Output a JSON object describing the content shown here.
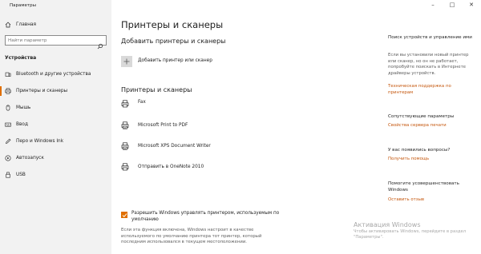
{
  "window": {
    "title": "Параметры",
    "controls": {
      "minimize": "–",
      "maximize": "□",
      "close": "✕"
    }
  },
  "sidebar": {
    "home": {
      "label": "Главная",
      "icon": "home-icon"
    },
    "search": {
      "placeholder": "Найти параметр"
    },
    "section": "Устройства",
    "items": [
      {
        "label": "Bluetooth и другие устройства",
        "icon": "bluetooth-icon"
      },
      {
        "label": "Принтеры и сканеры",
        "icon": "printer-icon",
        "active": true
      },
      {
        "label": "Мышь",
        "icon": "mouse-icon"
      },
      {
        "label": "Ввод",
        "icon": "keyboard-icon"
      },
      {
        "label": "Перо и Windows Ink",
        "icon": "pen-icon"
      },
      {
        "label": "Автозапуск",
        "icon": "autoplay-icon"
      },
      {
        "label": "USB",
        "icon": "usb-icon"
      }
    ]
  },
  "main": {
    "title": "Принтеры и сканеры",
    "add_section": {
      "title": "Добавить принтеры и сканеры",
      "button_label": "Добавить принтер или сканер"
    },
    "printers_section": {
      "title": "Принтеры и сканеры",
      "printers": [
        {
          "name": "Fax",
          "icon": "fax-icon"
        },
        {
          "name": "Microsoft Print to PDF",
          "icon": "printer-document-icon"
        },
        {
          "name": "Microsoft XPS Document Writer",
          "icon": "printer-document-icon"
        },
        {
          "name": "Отправить в OneNote 2010",
          "icon": "printer-icon"
        }
      ]
    },
    "default_printer": {
      "checked": true,
      "label": "Разрешить Windows управлять принтером, используемым по умолчанию",
      "description": "Если эта функция включена, Windows настроит в качестве используемого по умолчанию принтера тот принтер, который последним использовался в текущем местоположении."
    }
  },
  "right": {
    "troubleshoot": {
      "heading": "Поиск устройств и управление ими",
      "text": "Если вы установили новый принтер или сканер, но он не работает, попробуйте поискать в Интернете драйверы устройств.",
      "link": "Техническая поддержка по принтерам"
    },
    "related": {
      "heading": "Сопутствующие параметры",
      "link": "Свойства сервера печати"
    },
    "questions": {
      "heading": "У вас появились вопросы?",
      "link": "Получить помощь"
    },
    "feedback": {
      "heading": "Помогите усовершенствовать Windows",
      "link": "Оставить отзыв"
    }
  },
  "watermark": {
    "title": "Активация Windows",
    "text": "Чтобы активировать Windows, перейдите в раздел \"Параметры\"."
  },
  "colors": {
    "accent": "#e06f00",
    "link": "#c5570d",
    "sidebar_bg": "#f2f2f2"
  }
}
